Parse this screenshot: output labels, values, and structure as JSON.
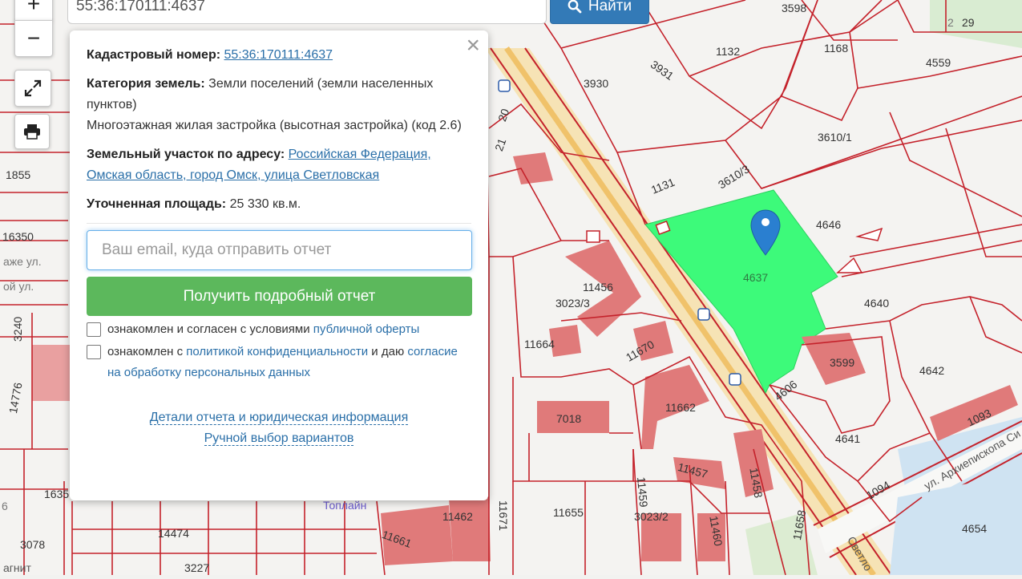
{
  "search": {
    "value": "55:36:170111:4637",
    "button_label": "Найти"
  },
  "controls": {
    "zoom_in": "+",
    "zoom_out": "−"
  },
  "popup": {
    "close_symbol": "×",
    "cadastral_label": "Кадастровый номер:",
    "cadastral_number": "55:36:170111:4637",
    "category_label": "Категория земель:",
    "category_value": "Земли поселений (земли населенных пунктов)",
    "usage_value": "Многоэтажная жилая застройка (высотная застройка) (код 2.6)",
    "address_label": "Земельный участок по адресу:",
    "address_value": "Российская Федерация, Омская область, город Омск, улица Светловская",
    "area_label": "Уточненная площадь:",
    "area_value": "25 330 кв.м.",
    "email_placeholder": "Ваш email, куда отправить отчет",
    "report_button": "Получить подробный отчет",
    "consent1_text": "ознакомлен и согласен с условиями ",
    "consent1_link": "публичной оферты",
    "consent2_text1": "ознакомлен с ",
    "consent2_link1": "политикой конфиденциальности",
    "consent2_text2": " и даю ",
    "consent2_link2": "согласие на обработку персональных данных",
    "details_link": "Детали отчета и юридическая информация",
    "manual_link": "Ручной выбор вариантов"
  },
  "map": {
    "selected_parcel": "4637",
    "parcel_labels": [
      "3598",
      "2",
      "29",
      "1132",
      "1168",
      "4559",
      "3931",
      "3930",
      "3610/1",
      "3610/3",
      "1131",
      "4646",
      "4640",
      "11456",
      "3023/3",
      "11664",
      "11670",
      "3599",
      "4642",
      "4606",
      "11662",
      "7018",
      "1093",
      "4641",
      "1094",
      "11457",
      "11458",
      "11459",
      "11655",
      "11671",
      "11462",
      "11661",
      "3023/2",
      "11460",
      "11658",
      "4654",
      "14474",
      "3078",
      "3227",
      "1855",
      "16350",
      "3240",
      "14776",
      "1635",
      "6",
      "21",
      "20"
    ],
    "place_labels": [
      "Топлайн",
      "агнит"
    ],
    "street_labels": [
      "ул. Архиепископа Си",
      "Светло",
      "аже ул.",
      "ой ул."
    ],
    "colors": {
      "parcel_line": "#c4222b",
      "selected_fill": "#3dfa7a",
      "marker": "#2a7fd0",
      "building": "#e07a7a"
    }
  }
}
